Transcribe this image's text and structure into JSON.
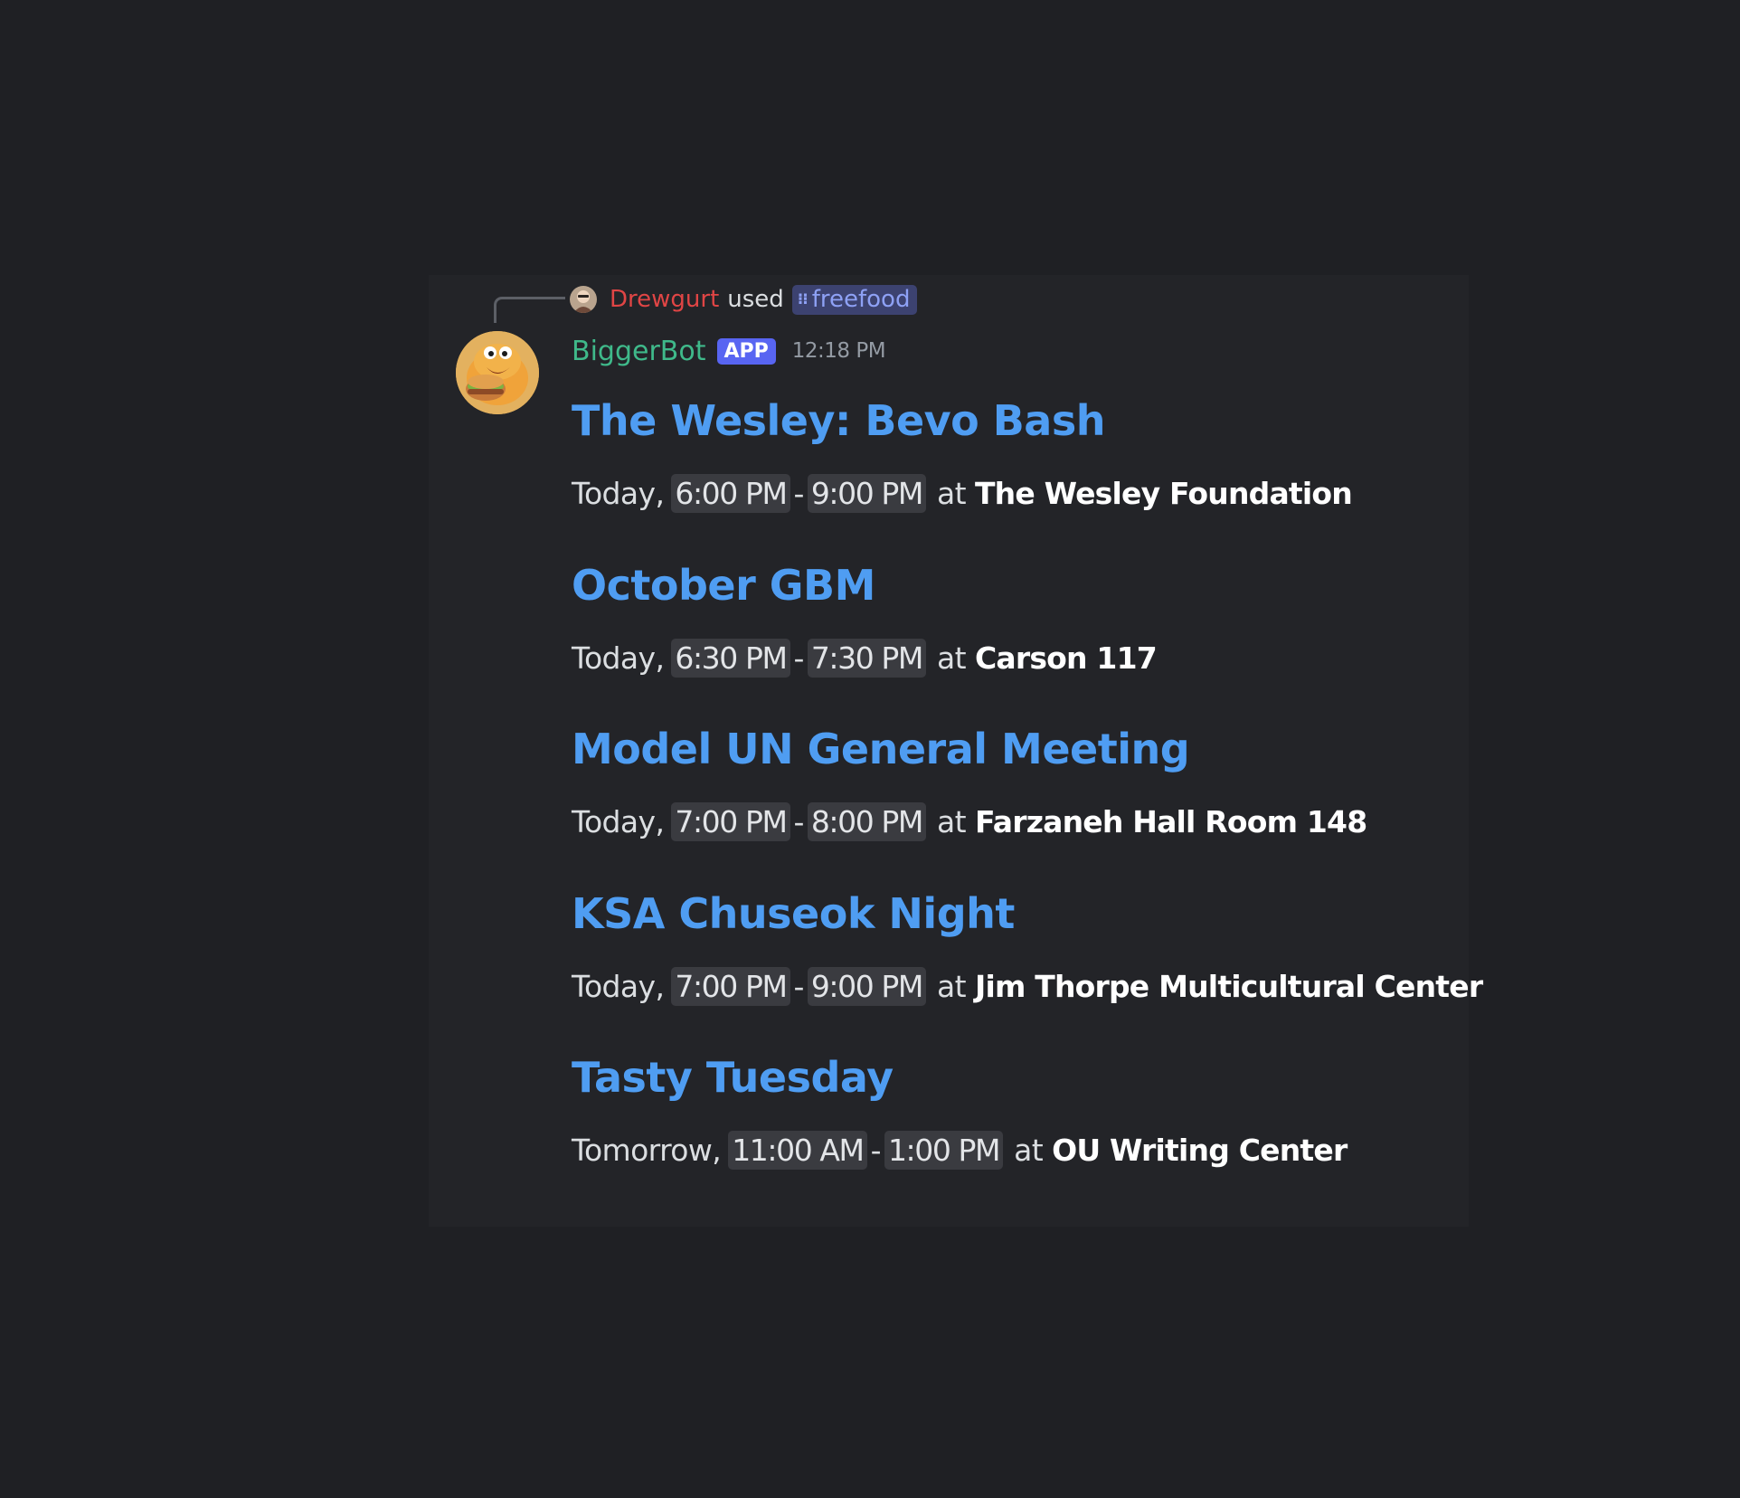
{
  "reply": {
    "user": "Drewgurt",
    "verb": "used",
    "command": "freefood"
  },
  "message": {
    "author": "BiggerBot",
    "badge": "APP",
    "timestamp": "12:18 PM"
  },
  "events": [
    {
      "title": "The Wesley: Bevo Bash",
      "day": "Today,",
      "start": "6:00 PM",
      "end": "9:00 PM",
      "at": "at",
      "location": "The Wesley Foundation"
    },
    {
      "title": "October GBM",
      "day": "Today,",
      "start": "6:30 PM",
      "end": "7:30 PM",
      "at": "at",
      "location": "Carson 117"
    },
    {
      "title": "Model UN General Meeting",
      "day": "Today,",
      "start": "7:00 PM",
      "end": "8:00 PM",
      "at": "at",
      "location": "Farzaneh Hall Room 148"
    },
    {
      "title": "KSA Chuseok Night",
      "day": "Today,",
      "start": "7:00 PM",
      "end": "9:00 PM",
      "at": "at",
      "location": "Jim Thorpe Multicultural Center"
    },
    {
      "title": "Tasty Tuesday",
      "day": "Tomorrow,",
      "start": "11:00 AM",
      "end": "1:00 PM",
      "at": "at",
      "location": "OU Writing Center"
    }
  ],
  "colors": {
    "background": "#1f2024",
    "card": "#232428",
    "event_title": "#4f9df2",
    "bot_name": "#3fb98a",
    "reply_user": "#e04545",
    "app_badge": "#5865f2",
    "command_chip": "#3c4270"
  }
}
